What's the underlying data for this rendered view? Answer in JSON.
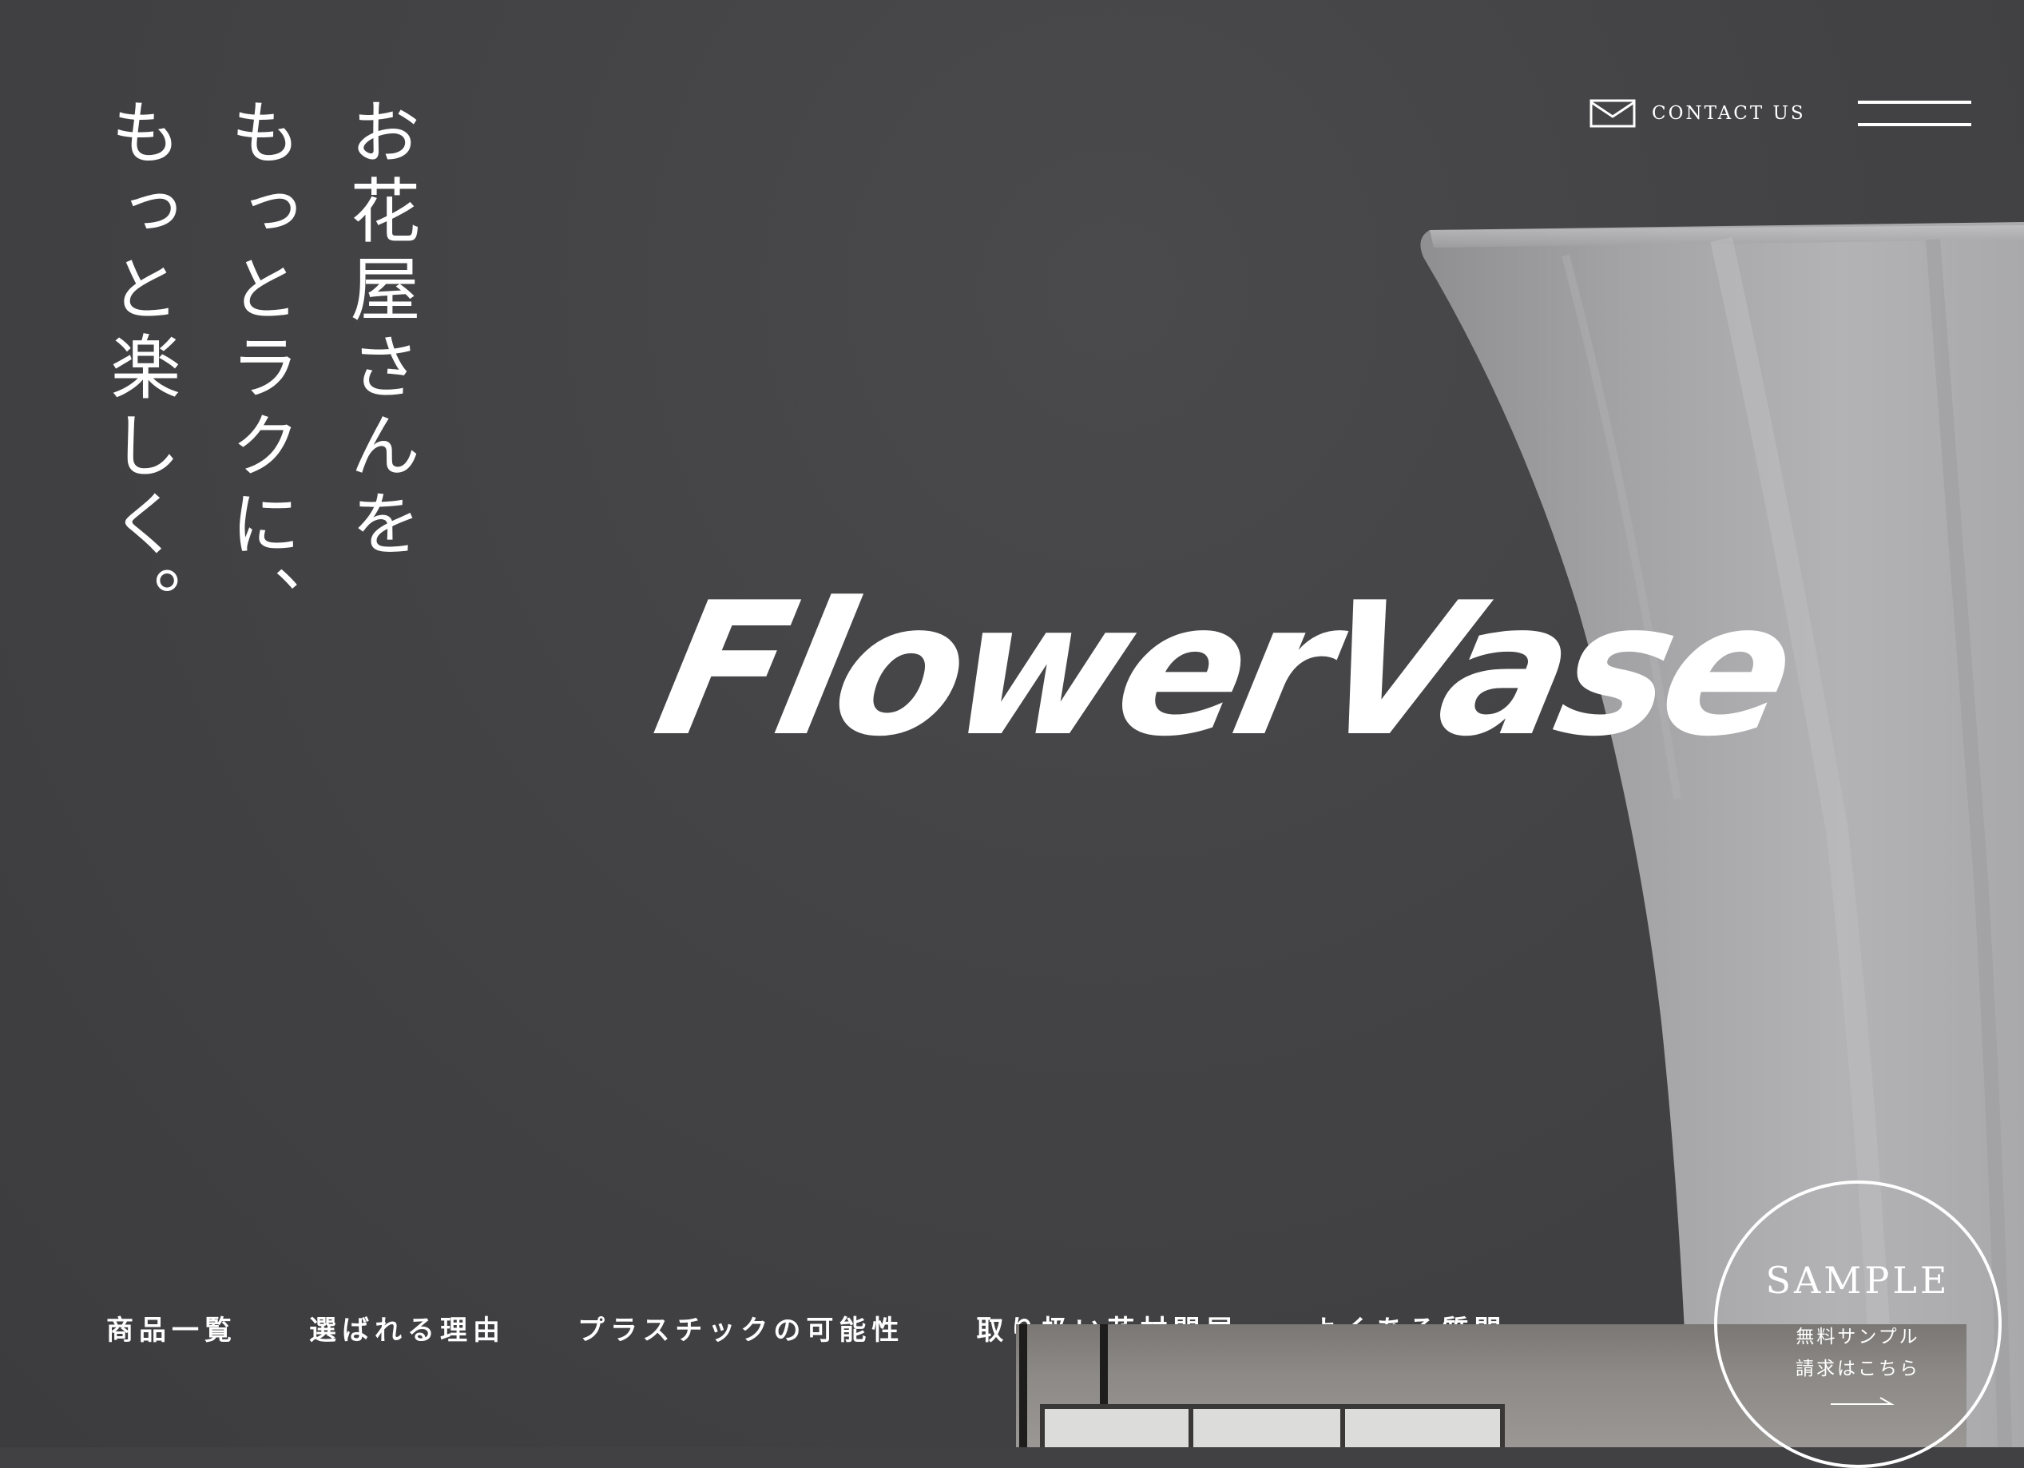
{
  "hero": {
    "tagline": [
      "お花屋さんを",
      "もっとラクに、",
      "もっと楽しく。"
    ],
    "logo": "FlowerVase"
  },
  "header": {
    "contact_label": "CONTACT US",
    "contact_icon": "mail-icon",
    "menu_icon": "hamburger-menu-icon"
  },
  "nav": {
    "items": [
      "商品一覧",
      "選ばれる理由",
      "プラスチックの可能性",
      "取り扱い花材問屋",
      "よくある質問"
    ]
  },
  "sample": {
    "title": "SAMPLE",
    "line1": "無料サンプル",
    "line2": "請求はこちら",
    "arrow_icon": "arrow-right-icon"
  },
  "colors": {
    "background": "#414143",
    "text": "#ffffff",
    "vase": "#a8a8aa"
  }
}
